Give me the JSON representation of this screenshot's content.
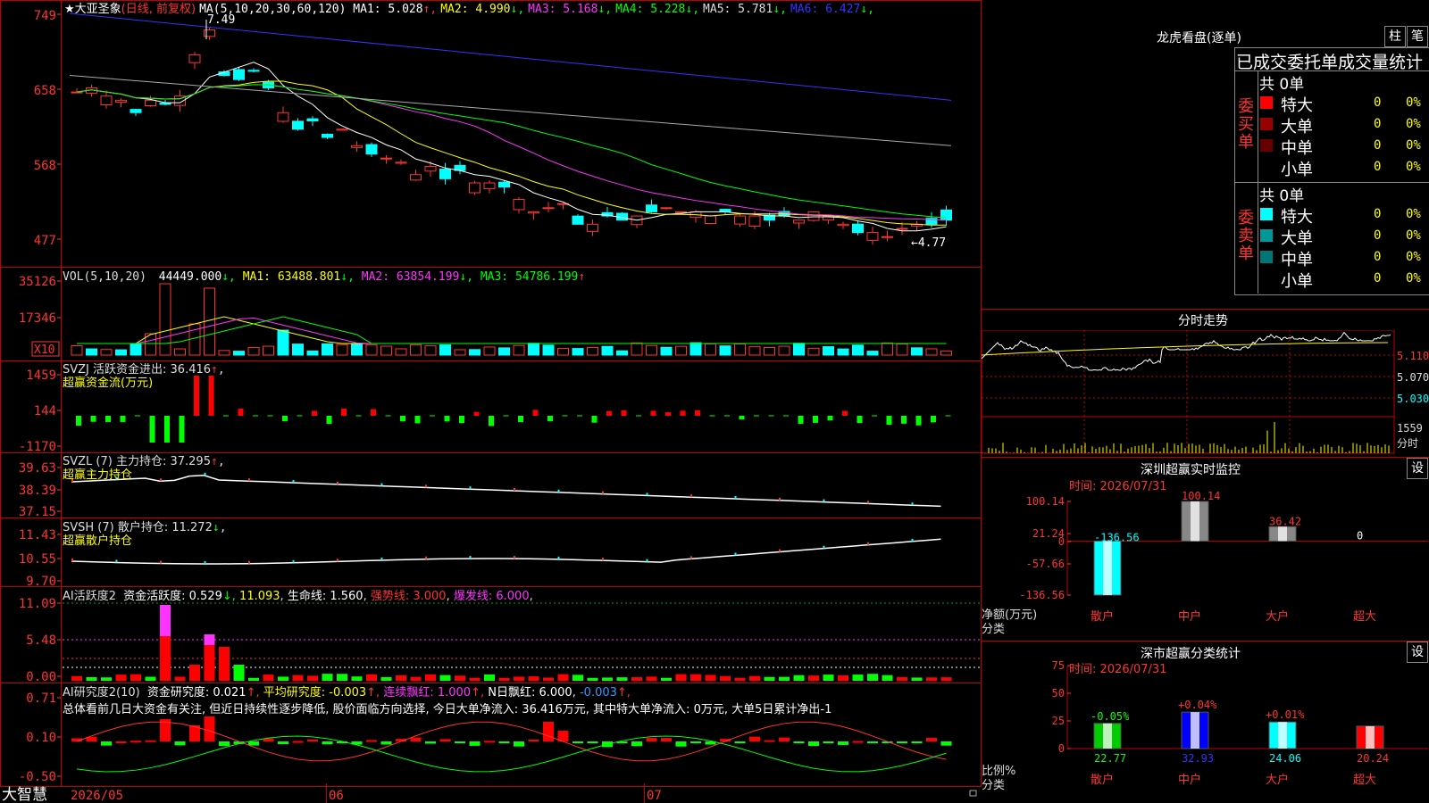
{
  "app": {
    "brand": "大智慧"
  },
  "kline": {
    "stock_name": "大亚圣象",
    "period_label": "(日线, 前复权)",
    "ma_prefix": "MA(5,10,20,30,60,120)",
    "ma_values": [
      {
        "label": "MA1: 5.028",
        "arrow": "↑",
        "color": "#ffffff"
      },
      {
        "label": "MA2: 4.990",
        "arrow": "↓",
        "color": "#ffff00"
      },
      {
        "label": "MA3: 5.168",
        "arrow": "↓",
        "color": "#ff33ff"
      },
      {
        "label": "MA4: 5.228",
        "arrow": "↓",
        "color": "#00ff00"
      },
      {
        "label": "MA5: 5.781",
        "arrow": "↓",
        "color": "#dddddd"
      },
      {
        "label": "MA6: 6.427",
        "arrow": "↓",
        "color": "#3333ff"
      }
    ],
    "y_ticks": [
      "749",
      "658",
      "568",
      "477"
    ],
    "high_label": "7.49",
    "low_label": "←4.77"
  },
  "vol": {
    "title": "VOL(5,10,20)",
    "value": "44449.000",
    "ma1": "MA1: 63488.801",
    "ma2": "MA2: 63854.199",
    "ma3": "MA3: 54786.199",
    "y_ticks": [
      "35126",
      "17346"
    ],
    "unit_badge": "X10"
  },
  "svzj": {
    "title": "SVZJ  活跃资金进出: 36.416",
    "arrow": "↑",
    "subtitle": "超赢资金流(万元)",
    "y_ticks": [
      "1459",
      "144",
      "-1170"
    ]
  },
  "svzl": {
    "title": "SVZL (7) 主力持仓: 37.295",
    "arrow": "↑",
    "subtitle": "超赢主力持仓",
    "y_ticks": [
      "39.63",
      "38.39",
      "37.15"
    ]
  },
  "svsh": {
    "title": "SVSH (7) 散户持仓: 11.272",
    "arrow": "↓",
    "subtitle": "超赢散户持仓",
    "y_ticks": [
      "11.43",
      "10.55",
      "9.70"
    ]
  },
  "ai_active": {
    "title": "AI活跃度2",
    "fund_active": "资金活跃度: 0.529",
    "v2": "11.093",
    "life_line": "生命线: 1.560",
    "strong_line": "强势线: 3.000",
    "burst_line": "爆发线: 6.000",
    "y_ticks": [
      "11.09",
      "5.48",
      "0.00"
    ]
  },
  "ai_research": {
    "title": "AI研究度2(10)",
    "fund_research": "资金研究度: 0.021",
    "avg_research": "平均研究度: -0.003",
    "consec_red": "连续飘红: 1.000",
    "n_day_red": "N日飘红: 6.000",
    "v5": "-0.003",
    "comment": "总体看前几日大资金有关注, 但近日持续性逐步降低, 股价面临方向选择, 今日大单净流入: 36.416万元, 其中特大单净流入: 0万元, 大单5日累计净出-1",
    "y_ticks": [
      "0.71",
      "0.10",
      "-0.50"
    ]
  },
  "x_axis": {
    "labels": [
      "2026/05",
      "06",
      "07"
    ]
  },
  "dragon": {
    "title": "龙虎看盘(逐单)",
    "tab_bar": "柱",
    "tab_pen": "笔",
    "header": "已成交委托单成交量统计",
    "buy": {
      "side_label": "委买单",
      "total": "共 0单",
      "rows": [
        {
          "name": "特大",
          "qty": "0",
          "pct": "0%",
          "color": "#ff0000"
        },
        {
          "name": "大单",
          "qty": "0",
          "pct": "0%",
          "color": "#990000"
        },
        {
          "name": "中单",
          "qty": "0",
          "pct": "0%",
          "color": "#660000"
        },
        {
          "name": "小单",
          "qty": "0",
          "pct": "0%",
          "color": ""
        }
      ]
    },
    "sell": {
      "side_label": "委卖单",
      "total": "共 0单",
      "rows": [
        {
          "name": "特大",
          "qty": "0",
          "pct": "0%",
          "color": "#00ffff"
        },
        {
          "name": "大单",
          "qty": "0",
          "pct": "0%",
          "color": "#009999"
        },
        {
          "name": "中单",
          "qty": "0",
          "pct": "0%",
          "color": "#007777"
        },
        {
          "name": "小单",
          "qty": "0",
          "pct": "0%",
          "color": ""
        }
      ]
    }
  },
  "intraday": {
    "title": "分时走势",
    "prices": [
      "5.110",
      "5.070",
      "5.030"
    ],
    "vol_label": "1559",
    "vol_unit": "分时"
  },
  "sz_monitor": {
    "title": "深圳超赢实时监控",
    "settings": "设",
    "time_label": "时间: 2026/07/31",
    "y_ticks": [
      "100.14",
      "21.24",
      "0",
      "-57.66",
      "-136.56"
    ],
    "axis_title": "净额(万元)",
    "axis_sub": "分类",
    "chart_data": {
      "type": "bar",
      "categories": [
        "散户",
        "中户",
        "大户",
        "超大"
      ],
      "values": [
        -136.56,
        100.14,
        36.42,
        0
      ],
      "value_labels": [
        "-136.56",
        "100.14",
        "36.42",
        "0"
      ],
      "ylim": [
        -136.56,
        100.14
      ]
    }
  },
  "sz_classify": {
    "title": "深市超赢分类统计",
    "settings": "设",
    "time_label": "时间: 2026/07/31",
    "y_ticks": [
      "75",
      "50",
      "25",
      "0"
    ],
    "axis_title": "比例%",
    "axis_sub": "分类",
    "chart_data": {
      "type": "bar",
      "categories": [
        "散户",
        "中户",
        "大户",
        "超大"
      ],
      "values": [
        22.77,
        32.93,
        24.06,
        20.24
      ],
      "value_labels": [
        "22.77",
        "32.93",
        "24.06",
        "20.24"
      ],
      "changes": [
        "-0.05%",
        "+0.04%",
        "+0.01%",
        ""
      ],
      "ylim": [
        0,
        75
      ]
    }
  }
}
